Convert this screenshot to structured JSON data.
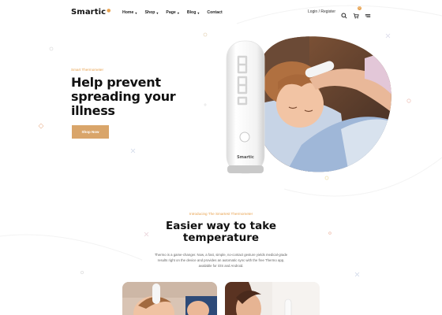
{
  "brand": {
    "name": "Smartic",
    "accent": "#e8a24f",
    "button_color": "#d9a56a"
  },
  "nav": {
    "items": [
      {
        "label": "Home",
        "has_dropdown": true
      },
      {
        "label": "Shop",
        "has_dropdown": true
      },
      {
        "label": "Page",
        "has_dropdown": true
      },
      {
        "label": "Blog",
        "has_dropdown": true
      },
      {
        "label": "Contact",
        "has_dropdown": false
      }
    ],
    "login_label": "Login / Register",
    "icons": [
      "search-icon",
      "cart-icon",
      "menu-icon"
    ],
    "cart_count": "0"
  },
  "hero": {
    "subtitle": "Smart Thermometer",
    "title": "Help prevent spreading your illness",
    "button_label": "Shop Now",
    "device_brand": "Smartic",
    "device_display": "88.8"
  },
  "features": {
    "label": "Introducing The Smartest Thermometer",
    "title": "Easier way to take temperature",
    "description": "Thermo is a game-changer. Now, a fast, simple, no-contact gesture yields medical-grade results right on the device and provides an automatic sync with the free Thermo app, available for iOS and Android."
  }
}
